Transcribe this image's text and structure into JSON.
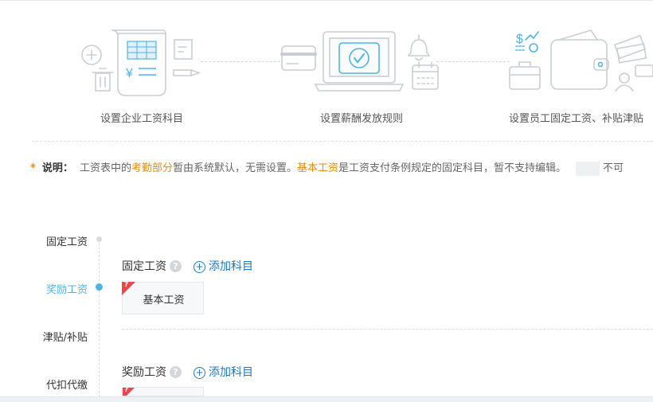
{
  "steps": [
    {
      "label": "设置企业工资科目"
    },
    {
      "label": "设置薪酬发放规则"
    },
    {
      "label": "设置员工固定工资、补贴津贴"
    }
  ],
  "note": {
    "star": "*",
    "title": "说明：",
    "t1": "工资表中的",
    "h1": "考勤部分",
    "t2": "暂由系统默认，无需设置。",
    "h2": "基本工资",
    "t3": "是工资支付条例规定的固定科目，暂不支持编辑。",
    "t4": "不可"
  },
  "nav": [
    {
      "label": "固定工资",
      "active": false
    },
    {
      "label": "奖励工资",
      "active": true
    },
    {
      "label": "津贴/补贴",
      "active": false
    },
    {
      "label": "代扣代缴",
      "active": false
    }
  ],
  "sections": [
    {
      "title": "固定工资",
      "help": "?",
      "add": "添加科目",
      "card": "基本工资"
    },
    {
      "title": "奖励工资",
      "help": "?",
      "add": "添加科目"
    }
  ],
  "colors": {
    "accent": "#4fb3e6",
    "highlight": "#f08a00",
    "link": "#1f78c2",
    "badge": "#e8474c"
  },
  "icons": [
    "plus-icon",
    "trash-icon",
    "payroll-document-icon",
    "edit-icon",
    "pencil-icon",
    "credit-card-icon",
    "laptop-check-icon",
    "bell-icon",
    "calendar-icon",
    "money-stats-icon",
    "briefcase-icon",
    "wallet-icon",
    "cash-stack-icon",
    "user-icon"
  ]
}
